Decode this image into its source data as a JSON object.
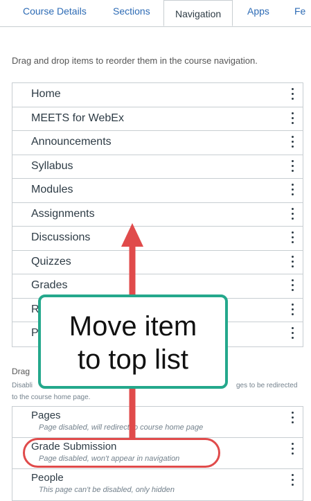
{
  "tabs": [
    {
      "label": "Course Details"
    },
    {
      "label": "Sections"
    },
    {
      "label": "Navigation"
    },
    {
      "label": "Apps"
    },
    {
      "label": "Fe"
    }
  ],
  "instruction": "Drag and drop items to reorder them in the course navigation.",
  "enabled_items": [
    {
      "label": "Home"
    },
    {
      "label": "MEETS for WebEx"
    },
    {
      "label": "Announcements"
    },
    {
      "label": "Syllabus"
    },
    {
      "label": "Modules"
    },
    {
      "label": "Assignments"
    },
    {
      "label": "Discussions"
    },
    {
      "label": "Quizzes"
    },
    {
      "label": "Grades"
    },
    {
      "label": "R"
    },
    {
      "label": "P"
    }
  ],
  "hidden_section": {
    "drag_label": "Drag",
    "note_left": "Disabli",
    "note_right": "ges to be redirected",
    "note_line2": "to the course home page."
  },
  "hidden_items": [
    {
      "label": "Pages",
      "note": "Page disabled, will redirect to course home page"
    },
    {
      "label": "Grade Submission",
      "note": "Page disabled, won't appear in navigation"
    },
    {
      "label": "People",
      "note": "This page can't be disabled, only hidden"
    }
  ],
  "annotation": {
    "line1": "Move item",
    "line2": "to top list",
    "arrow_color": "#e04b4b",
    "callout_border": "#24a88c"
  }
}
